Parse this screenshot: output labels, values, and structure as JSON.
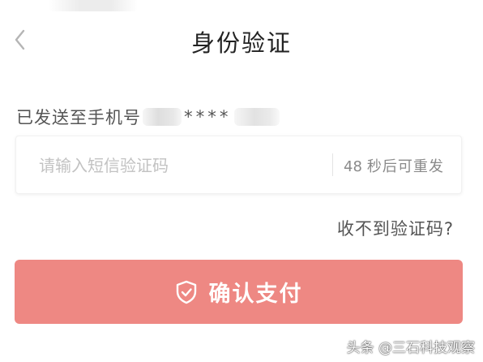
{
  "header": {
    "title": "身份验证",
    "back_icon": "chevron-left-icon"
  },
  "phone": {
    "label": "已发送至手机号",
    "masked": "****"
  },
  "code_input": {
    "placeholder": "请输入短信验证码",
    "value": "",
    "countdown_seconds": "48",
    "countdown_suffix": "秒后可重发"
  },
  "help": {
    "no_code_link": "收不到验证码?"
  },
  "confirm": {
    "label": "确认支付",
    "icon": "shield-check-icon",
    "color": "#ee8883"
  },
  "watermark": {
    "text": "头条 @三石科技观察"
  }
}
